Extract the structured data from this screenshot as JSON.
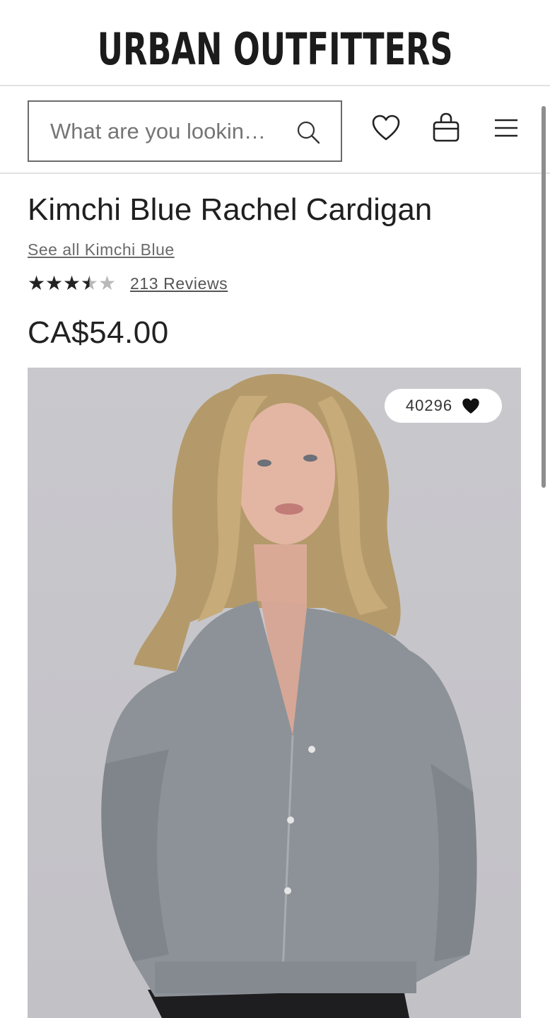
{
  "header": {
    "logo": "URBAN OUTFITTERS"
  },
  "search": {
    "placeholder": "What are you looking for?"
  },
  "product": {
    "title": "Kimchi Blue Rachel Cardigan",
    "brand_link": "See all Kimchi Blue",
    "rating": 3.5,
    "reviews_label": "213 Reviews",
    "price": "CA$54.00",
    "likes": "40296"
  },
  "icons": {
    "search": "search-icon",
    "wishlist": "heart-outline-icon",
    "bag": "shopping-bag-icon",
    "menu": "hamburger-menu-icon",
    "like": "heart-filled-icon"
  }
}
